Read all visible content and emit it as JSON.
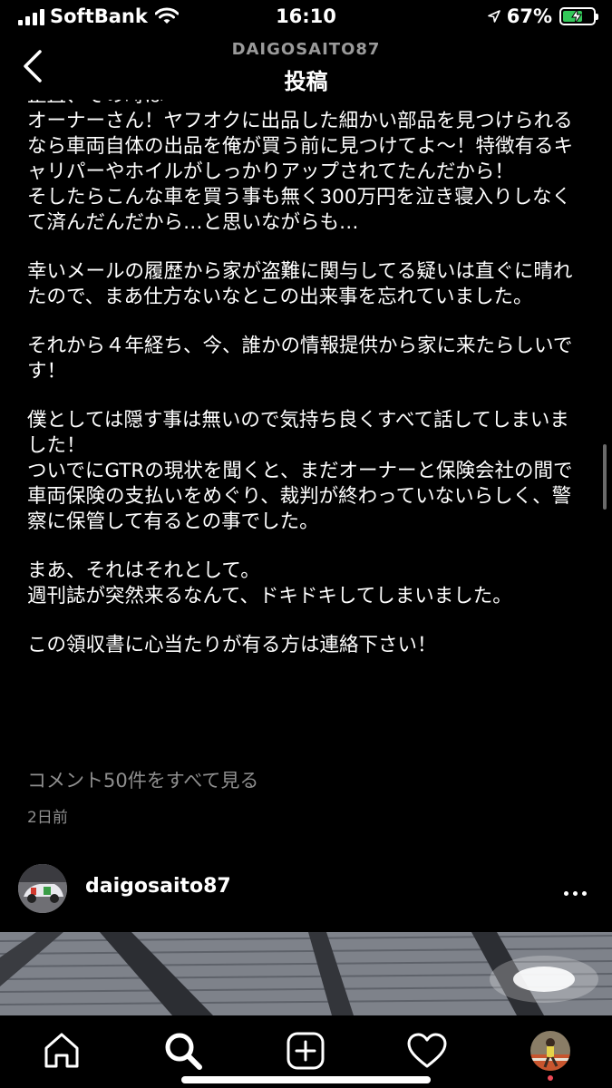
{
  "status_bar": {
    "carrier": "SoftBank",
    "time": "16:10",
    "battery_percent": "67%",
    "battery_level": 0.67
  },
  "header": {
    "username": "DAIGOSAITO87",
    "title": "投稿"
  },
  "caption": {
    "cut_line": "正直、その時は",
    "paragraphs": [
      [
        "オーナーさん！ヤフオクに出品した細かい部品を見つけられるなら車両自体の出品を俺が買う前に見つけてよ～！特徴有るキャリパーやホイルがしっかりアップされてたんだから！",
        "そしたらこんな車を買う事も無く300万円を泣き寝入りしなくて済んだんだから…と思いながらも…"
      ],
      [
        "幸いメールの履歴から家が盗難に関与してる疑いは直ぐに晴れたので、まあ仕方ないなとこの出来事を忘れていました。"
      ],
      [
        "それから４年経ち、今、誰かの情報提供から家に来たらしいです！"
      ],
      [
        "僕としては隠す事は無いので気持ち良くすべて話してしまいました！",
        "ついでにGTRの現状を聞くと、まだオーナーと保険会社の間で車両保険の支払いをめぐり、裁判が終わっていないらしく、警察に保管して有るとの事でした。"
      ],
      [
        "まあ、それはそれとして。",
        "週刊誌が突然来るなんて、ドキドキしてしまいました。"
      ],
      [
        "この領収書に心当たりが有る方は連絡下さい！"
      ]
    ]
  },
  "comments_link": "コメント50件をすべて見る",
  "post_date": "2日前",
  "next_post": {
    "username": "daigosaito87"
  },
  "icons": [
    "back-chevron-icon",
    "more-options-icon",
    "home-icon",
    "search-icon",
    "new-post-icon",
    "activity-heart-icon",
    "profile-avatar-icon"
  ],
  "colors": {
    "background": "#000000",
    "text": "#ffffff",
    "muted": "#8e8e8e",
    "battery_fill": "#33c759",
    "activity_dot": "#ed4956"
  }
}
